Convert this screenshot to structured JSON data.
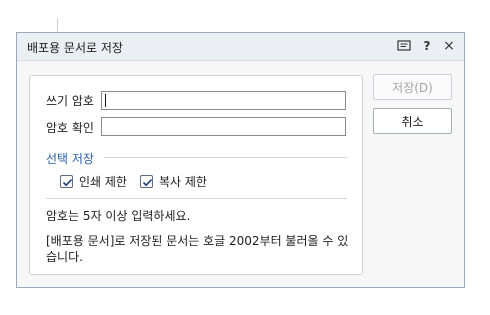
{
  "dialog": {
    "title": "배포용 문서로 저장",
    "memo_icon": "memo-icon",
    "help_label": "?",
    "close_label": "×"
  },
  "form": {
    "write_password_label": "쓰기 암호",
    "write_password_value": "",
    "confirm_password_label": "암호 확인",
    "confirm_password_value": ""
  },
  "options": {
    "section_title": "선택 저장",
    "print_restrict_label": "인쇄 제한",
    "print_restrict_checked": true,
    "copy_restrict_label": "복사 제한",
    "copy_restrict_checked": true
  },
  "notes": {
    "line1": "암호는 5자 이상 입력하세요.",
    "line2a": "[배포용 문서]로 저장된 문서는 호글 2002부터 불러올 수 있",
    "line2b": "습니다."
  },
  "buttons": {
    "save_label": "저장(D)",
    "cancel_label": "취소"
  },
  "colors": {
    "accent": "#2a5ea8",
    "titlebar": "#ebeef2"
  }
}
